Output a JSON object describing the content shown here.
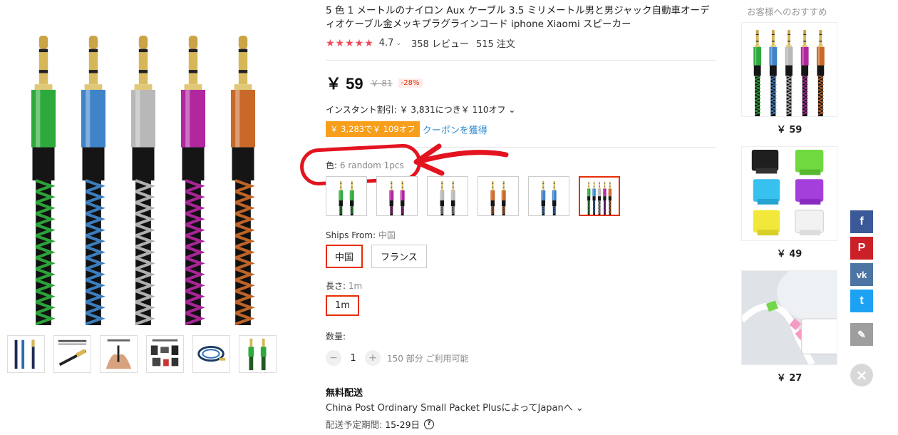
{
  "product": {
    "title": "5 色 1 メートルのナイロン Aux ケーブル 3.5 ミリメートル男と男ジャック自動車オーディオケーブル金メッキプラグラインコード iphone Xiaomi スピーカー",
    "stars": "★★★★★",
    "rating": "4.7",
    "reviews": "358 レビュー",
    "orders": "515 注文",
    "price": "￥ 59",
    "old_price": "￥ 81",
    "discount": "-28%",
    "instant_discount": "インスタント割引: ￥ 3,831につき￥ 110オフ ⌄",
    "coupon_tag": "￥ 3,283で￥ 109オフ",
    "coupon_link": "クーポンを獲得",
    "color_label": "色:",
    "color_value": "6 random 1pcs",
    "swatches": [
      {
        "colors": [
          "#2eaa3c"
        ],
        "selected": false
      },
      {
        "colors": [
          "#b0279e"
        ],
        "selected": false
      },
      {
        "colors": [
          "#b8b8b8"
        ],
        "selected": false
      },
      {
        "colors": [
          "#c8692a"
        ],
        "selected": false
      },
      {
        "colors": [
          "#3f84c8"
        ],
        "selected": false
      },
      {
        "colors": [
          "#2eaa3c",
          "#3f84c8",
          "#b8b8b8",
          "#b0279e",
          "#c8692a"
        ],
        "selected": true
      }
    ],
    "ships_from_label": "Ships From:",
    "ships_from_value": "中国",
    "ships_options": [
      {
        "label": "中国",
        "selected": true
      },
      {
        "label": "フランス",
        "selected": false
      }
    ],
    "length_label": "長さ:",
    "length_value": "1m",
    "length_options": [
      {
        "label": "1m",
        "selected": true
      }
    ],
    "quantity_label": "数量:",
    "quantity_minus": "−",
    "quantity_value": "1",
    "quantity_plus": "+",
    "quantity_available": "150 部分 ご利用可能",
    "shipping_title": "無料配送",
    "shipping_method": "China Post Ordinary Small Packet PlusによってJapanへ ⌄",
    "shipping_eta_label": "配送予定期間:",
    "shipping_eta": "15-29日",
    "shipping_help": "?"
  },
  "main_image_colors": [
    "#2eaa3c",
    "#3f84c8",
    "#b8b8b8",
    "#b0279e",
    "#c8692a"
  ],
  "recommendations": {
    "title": "お客様へのおすすめ",
    "items": [
      {
        "price": "￥ 59",
        "icon": "aux-cables-icon"
      },
      {
        "price": "￥ 49",
        "icon": "phone-stands-icon"
      },
      {
        "price": "￥ 27",
        "icon": "cable-protector-icon"
      }
    ]
  },
  "social": {
    "facebook": "f",
    "pinterest": "P",
    "vk": "vk",
    "twitter": "t",
    "edit": "✎",
    "close": "×",
    "colors": {
      "facebook": "#3b5998",
      "pinterest": "#cb2027",
      "vk": "#4c75a3",
      "twitter": "#1da1f2",
      "edit": "#9e9e9e"
    }
  }
}
